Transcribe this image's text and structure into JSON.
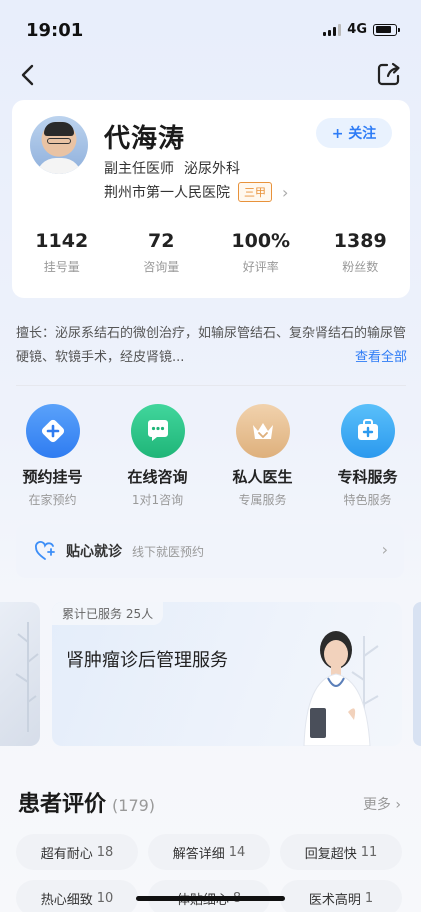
{
  "status_bar": {
    "time": "19:01",
    "network": "4G"
  },
  "doctor": {
    "name": "代海涛",
    "title": "副主任医师",
    "department": "泌尿外科",
    "hospital": "荆州市第一人民医院",
    "hospital_grade": "三甲",
    "follow_label": "+ 关注"
  },
  "stats": [
    {
      "value": "1142",
      "label": "挂号量"
    },
    {
      "value": "72",
      "label": "咨询量"
    },
    {
      "value": "100%",
      "label": "好评率"
    },
    {
      "value": "1389",
      "label": "粉丝数"
    }
  ],
  "specialty": {
    "text": "擅长：泌尿系结石的微创治疗，如输尿管结石、复杂肾结石的输尿管硬镜、软镜手术，经皮肾镜...",
    "view_all": "查看全部"
  },
  "services": [
    {
      "label": "预约挂号",
      "sub": "在家预约",
      "icon": "plus-diamond-icon",
      "color": "#3d8ef7"
    },
    {
      "label": "在线咨询",
      "sub": "1对1咨询",
      "icon": "chat-bubble-icon",
      "color": "#2fc48a"
    },
    {
      "label": "私人医生",
      "sub": "专属服务",
      "icon": "crown-icon",
      "color": "#e6b98a"
    },
    {
      "label": "专科服务",
      "sub": "特色服务",
      "icon": "medical-kit-icon",
      "color": "#3aa9f3"
    }
  ],
  "care_bar": {
    "title": "贴心就诊",
    "sub": "线下就医预约"
  },
  "banner": {
    "tag": "累计已服务 25人",
    "title": "肾肿瘤诊后管理服务"
  },
  "reviews": {
    "title": "患者评价",
    "count": "(179)",
    "more": "更多",
    "tags": [
      {
        "label": "超有耐心",
        "count": "18"
      },
      {
        "label": "解答详细",
        "count": "14"
      },
      {
        "label": "回复超快",
        "count": "11"
      },
      {
        "label": "热心细致",
        "count": "10"
      },
      {
        "label": "体贴细心",
        "count": "8"
      },
      {
        "label": "医术高明",
        "count": "1"
      }
    ]
  }
}
